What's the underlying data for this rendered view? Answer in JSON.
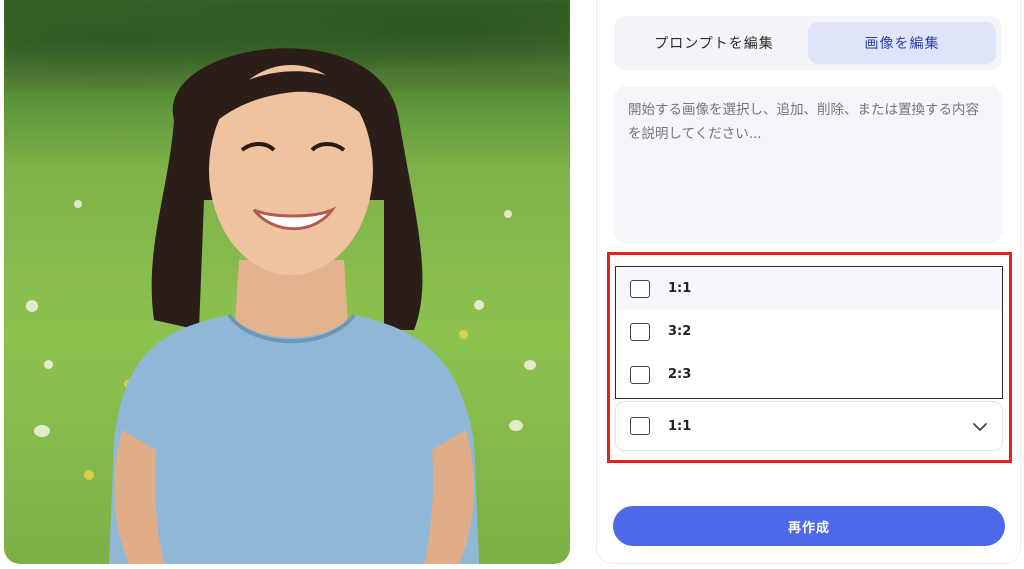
{
  "tabs": [
    {
      "label": "プロンプトを編集",
      "active": false
    },
    {
      "label": "画像を編集",
      "active": true
    }
  ],
  "prompt": {
    "placeholder": "開始する画像を選択し、追加、削除、または置換する内容を説明してください...",
    "value": ""
  },
  "aspect_ratio": {
    "options": [
      "1:1",
      "3:2",
      "2:3"
    ],
    "selected": "1:1"
  },
  "regenerate_label": "再作成",
  "colors": {
    "accent": "#4d68e8",
    "tab_active_bg": "#dfe4fb",
    "highlight": "#e0231c"
  },
  "icons": {
    "chevron": "chevron-down-icon",
    "checkbox": "checkbox-icon"
  }
}
